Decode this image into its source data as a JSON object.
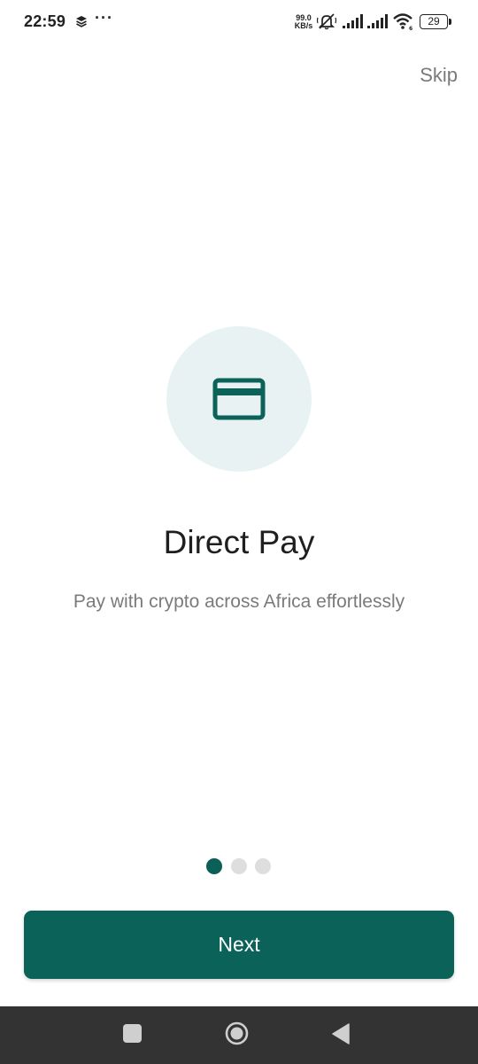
{
  "status_bar": {
    "time": "22:59",
    "more_indicator": "···",
    "network_speed_value": "99.0",
    "network_speed_unit": "KB/s",
    "battery_level": "29",
    "icons": [
      "layers-icon",
      "bell-muted-icon",
      "signal-icon",
      "signal-icon",
      "wifi-icon",
      "battery-icon"
    ]
  },
  "onboarding": {
    "skip_label": "Skip",
    "illustration_icon": "credit-card-icon",
    "title": "Direct Pay",
    "subtitle": "Pay with crypto across Africa effortlessly",
    "page_count": 3,
    "current_page": 1,
    "next_label": "Next"
  },
  "colors": {
    "accent": "#0b6259",
    "circle_background": "#e8f2f2",
    "inactive_dot": "#dedede",
    "nav_bar": "#333333"
  },
  "nav_bar": {
    "buttons": [
      "recent-apps-button",
      "home-button",
      "back-button"
    ]
  }
}
